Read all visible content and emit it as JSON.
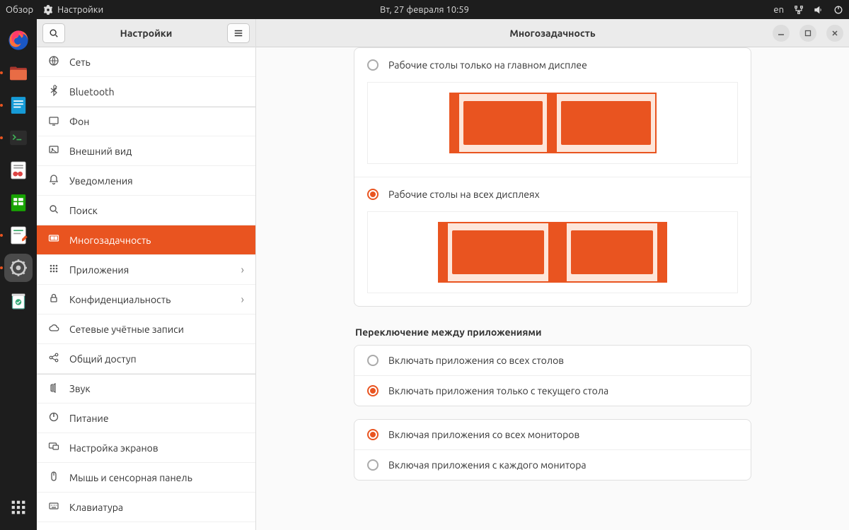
{
  "top": {
    "activities": "Обзор",
    "app": "Настройки",
    "datetime": "Вт, 27 февраля  10:59",
    "lang": "en"
  },
  "sidebar": {
    "title": "Настройки",
    "items": [
      {
        "icon": "globe",
        "label": "Сеть"
      },
      {
        "icon": "bluetooth",
        "label": "Bluetooth"
      },
      {
        "icon": "wallpaper",
        "label": "Фон",
        "sep": true
      },
      {
        "icon": "appearance",
        "label": "Внешний вид"
      },
      {
        "icon": "bell",
        "label": "Уведомления"
      },
      {
        "icon": "search",
        "label": "Поиск"
      },
      {
        "icon": "monitor",
        "label": "Многозадачность",
        "active": true
      },
      {
        "icon": "grid",
        "label": "Приложения",
        "chevron": true
      },
      {
        "icon": "lock",
        "label": "Конфиденциальность",
        "chevron": true
      },
      {
        "icon": "cloud",
        "label": "Сетевые учётные записи"
      },
      {
        "icon": "share",
        "label": "Общий доступ"
      },
      {
        "icon": "sound",
        "label": "Звук",
        "sep": true
      },
      {
        "icon": "power",
        "label": "Питание"
      },
      {
        "icon": "displays",
        "label": "Настройка экранов"
      },
      {
        "icon": "mouse",
        "label": "Мышь и сенсорная панель"
      },
      {
        "icon": "keyboard",
        "label": "Клавиатура"
      }
    ]
  },
  "content": {
    "title": "Многозадачность",
    "multi_monitor": {
      "opt1": {
        "label": "Рабочие столы только на главном дисплее",
        "checked": false
      },
      "opt2": {
        "label": "Рабочие столы на всех дисплеях",
        "checked": true
      }
    },
    "app_switch": {
      "title": "Переключение между приложениями",
      "opt1": {
        "label": "Включать приложения со всех столов",
        "checked": false
      },
      "opt2": {
        "label": "Включать приложения только с текущего стола",
        "checked": true
      },
      "opt3": {
        "label": "Включая приложения со всех мониторов",
        "checked": true
      },
      "opt4": {
        "label": "Включая приложения с каждого монитора",
        "checked": false
      }
    }
  }
}
